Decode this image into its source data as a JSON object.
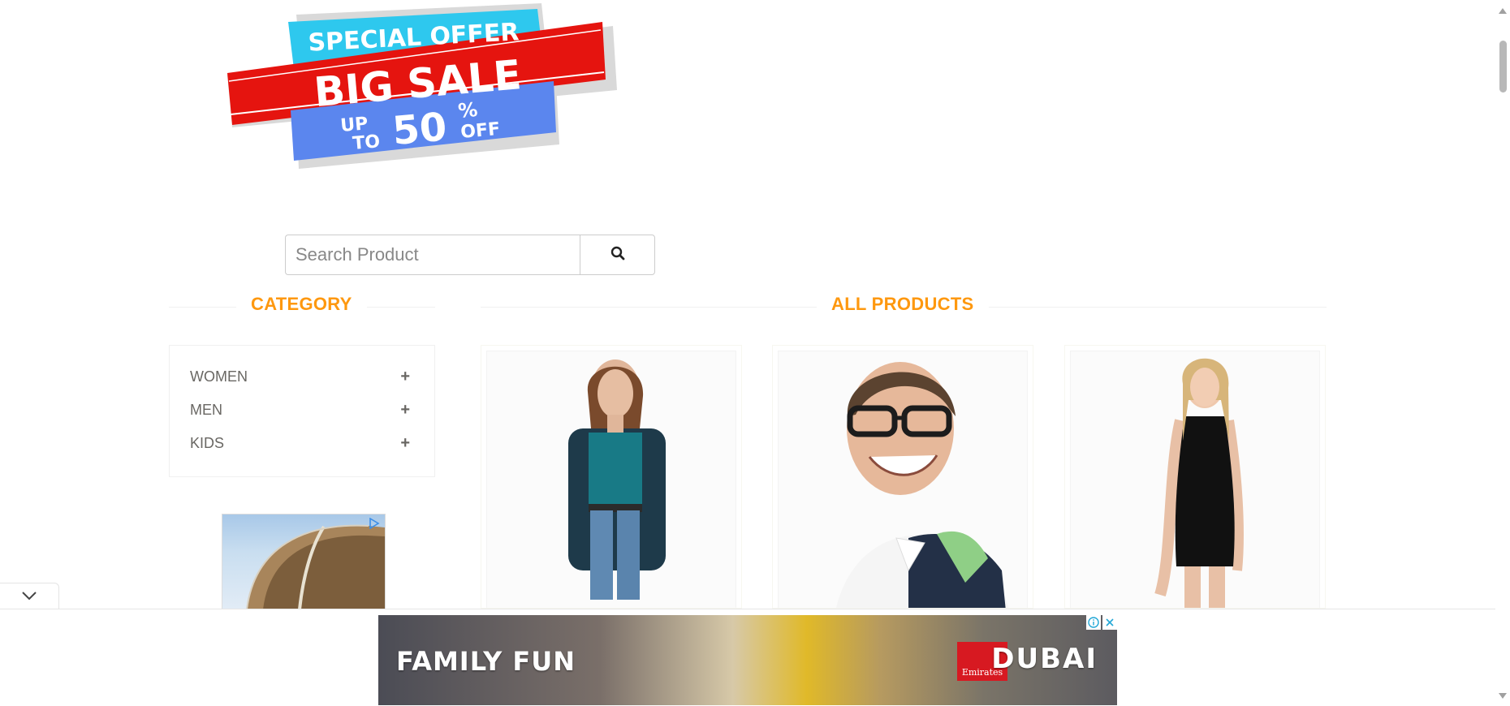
{
  "banner": {
    "line1": "SPECIAL OFFER",
    "line2": "BIG SALE",
    "up": "UP",
    "to": "TO",
    "percent_value": "50",
    "percent_sign": "%",
    "off": "OFF",
    "colors": {
      "cyan": "#2ec8ee",
      "red": "#e5140f",
      "blue": "#5b86ee"
    }
  },
  "search": {
    "placeholder": "Search Product",
    "icon": "search-icon"
  },
  "category": {
    "title": "CATEGORY",
    "items": [
      {
        "label": "WOMEN",
        "icon": "plus-icon"
      },
      {
        "label": "MEN",
        "icon": "plus-icon"
      },
      {
        "label": "KIDS",
        "icon": "plus-icon"
      }
    ]
  },
  "products": {
    "title": "ALL PRODUCTS",
    "cards": [
      {
        "image": "woman-casual-outfit-image"
      },
      {
        "image": "man-with-glasses-image"
      },
      {
        "image": "woman-black-dress-image"
      }
    ]
  },
  "side_ad": {
    "icon": "ad-choices-icon"
  },
  "bottom_ad": {
    "headline": "FAMILY FUN",
    "brand_logo": "Emirates",
    "destination": "DUBAI",
    "info_icon": "info-icon",
    "close_icon": "close-icon"
  },
  "theme": {
    "accent": "#fe980f",
    "text": "#696763"
  }
}
